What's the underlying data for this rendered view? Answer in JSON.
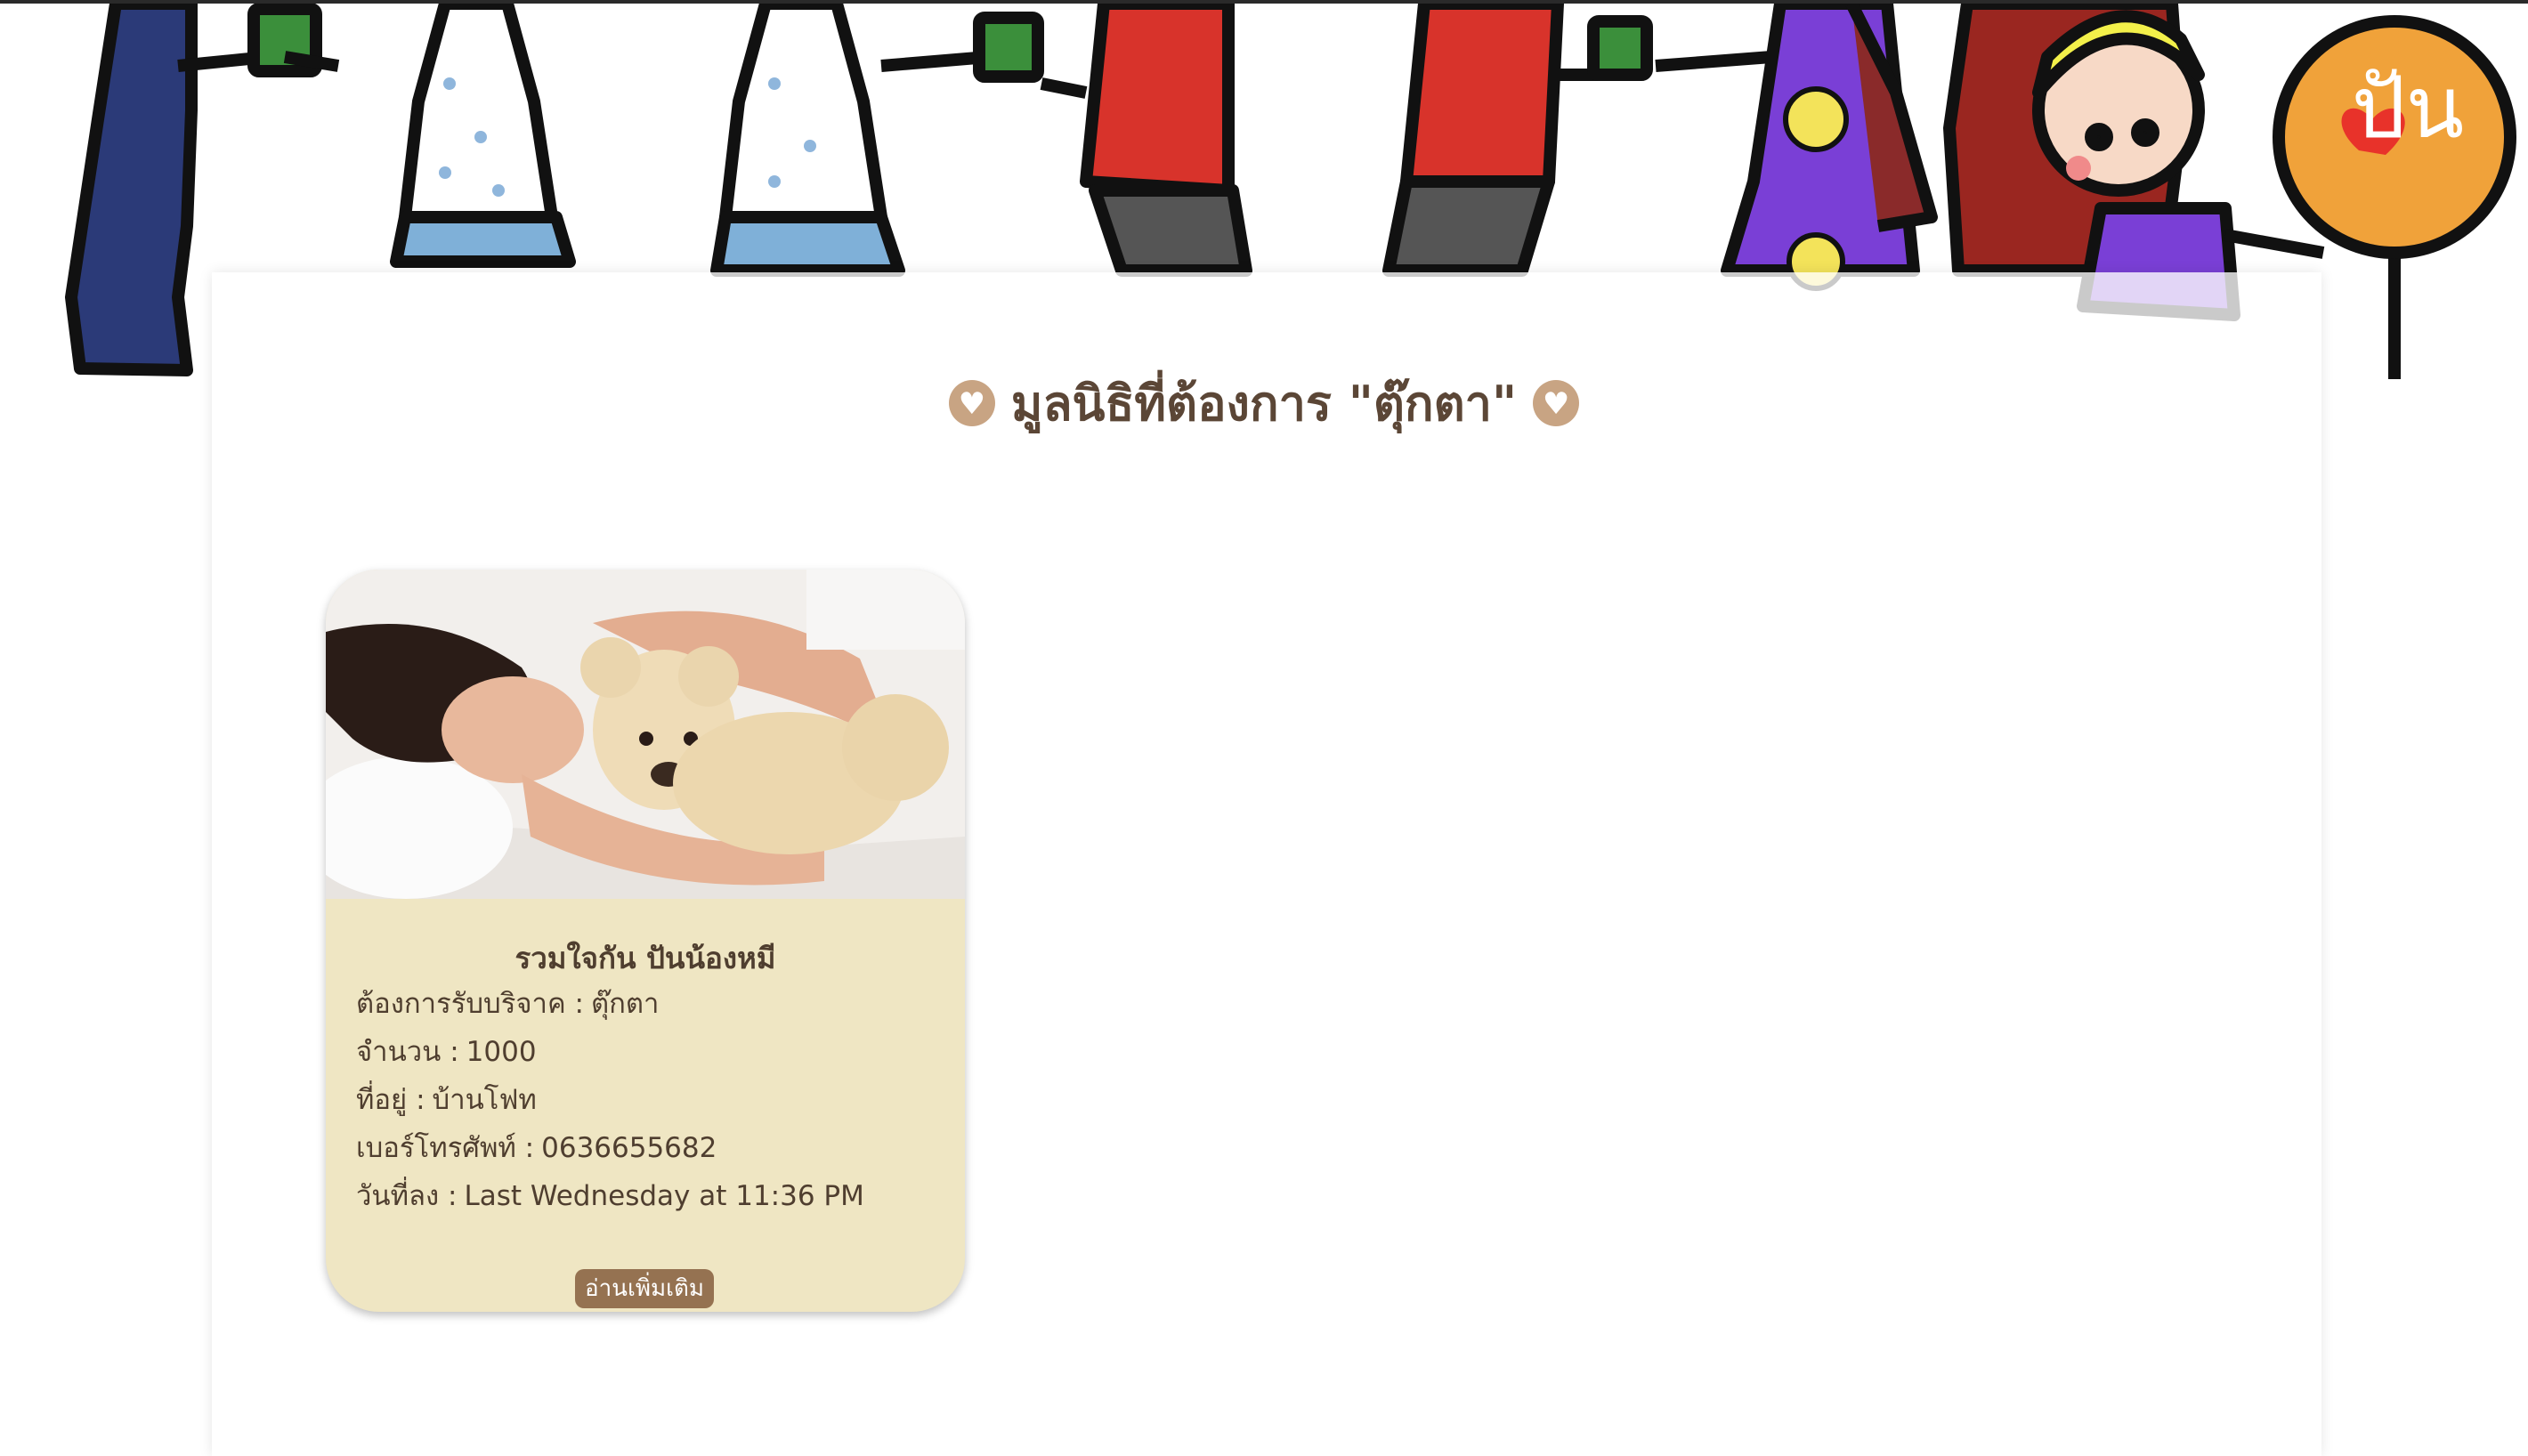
{
  "page": {
    "title": "มูลนิธิที่ต้องการ \"ตุ๊กตา\""
  },
  "colors": {
    "accent": "#c8a483",
    "title_text": "#5b4636",
    "card_bg": "#efe6c3",
    "button_bg": "#957251"
  },
  "banner": {
    "logo_text": "ปัน"
  },
  "card": {
    "title": "รวมใจกัน ปันน้องหมี",
    "fields": [
      {
        "label": "ต้องการรับบริจาค :",
        "value": "ตุ๊กตา"
      },
      {
        "label": "จำนวน :",
        "value": "1000"
      },
      {
        "label": "ที่อยู่ :",
        "value": "บ้านโฟท"
      },
      {
        "label": "เบอร์โทรศัพท์ :",
        "value": "0636655682"
      },
      {
        "label": "วันที่ลง :",
        "value": "Last Wednesday at 11:36 PM"
      }
    ],
    "button_label": "อ่านเพิ่มเติม"
  }
}
